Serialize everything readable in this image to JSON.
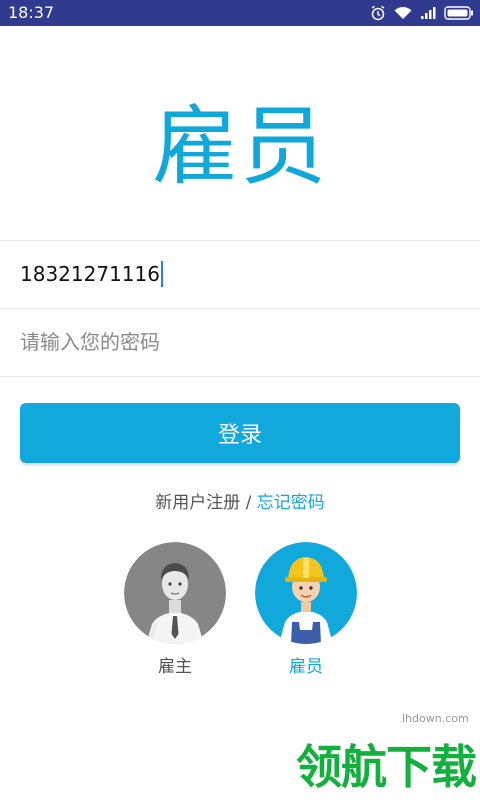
{
  "status_bar": {
    "time": "18:37"
  },
  "header": {
    "title": "雇员"
  },
  "form": {
    "phone_value": "18321271116",
    "password_placeholder": "请输入您的密码",
    "login_label": "登录"
  },
  "links": {
    "register": "新用户注册",
    "separator": " / ",
    "forgot_password": "忘记密码"
  },
  "roles": [
    {
      "label": "雇主",
      "selected": false
    },
    {
      "label": "雇员",
      "selected": true
    }
  ],
  "watermark": {
    "brand": "领航下载",
    "site": "lhdown.com"
  },
  "colors": {
    "accent": "#10a7d9",
    "status_bar": "#303a8e",
    "watermark": "#13b03e"
  }
}
